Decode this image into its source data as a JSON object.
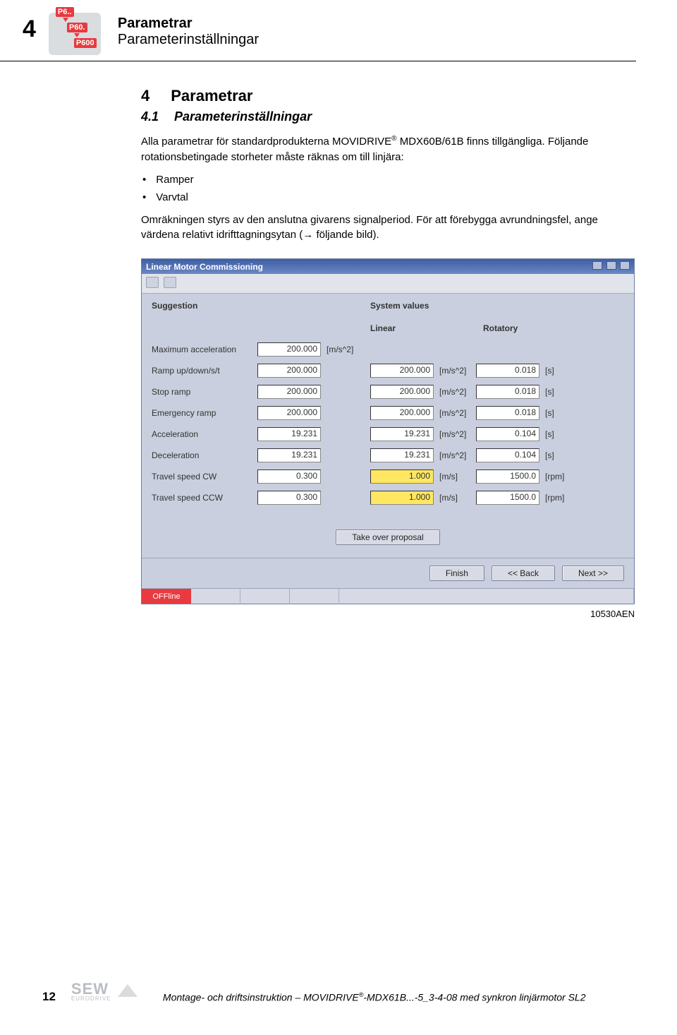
{
  "header": {
    "section_number": "4",
    "icon": {
      "p6": "P6..",
      "p60": "P60.",
      "p600": "P600"
    },
    "title_bold": "Parametrar",
    "title_sub": "Parameterinställningar"
  },
  "content": {
    "h4_num": "4",
    "h4_text": "Parametrar",
    "h41_num": "4.1",
    "h41_text": "Parameterinställningar",
    "para1a": "Alla parametrar för standardprodukterna MOVIDRIVE",
    "para1b": " MDX60B/61B finns tillgängliga. Följande rotationsbetingade storheter måste räknas om till linjära:",
    "bullets": [
      "Ramper",
      "Varvtal"
    ],
    "para2": "Omräkningen styrs av den anslutna givarens signalperiod. För att förebygga avrundningsfel, ange värdena relativt idrifttagningsytan (→ följande bild)."
  },
  "window": {
    "title": "Linear Motor Commissioning",
    "suggestion_label": "Suggestion",
    "system_values_label": "System values",
    "linear_label": "Linear",
    "rotatory_label": "Rotatory",
    "rows": [
      {
        "label": "Maximum acceleration",
        "sugg": "200.000",
        "sugg_unit": "[m/s^2]",
        "lin": "",
        "lin_unit": "",
        "rot": "",
        "rot_unit": ""
      },
      {
        "label": "Ramp up/down/s/t",
        "sugg": "200.000",
        "sugg_unit": "",
        "lin": "200.000",
        "lin_unit": "[m/s^2]",
        "rot": "0.018",
        "rot_unit": "[s]"
      },
      {
        "label": "Stop ramp",
        "sugg": "200.000",
        "sugg_unit": "",
        "lin": "200.000",
        "lin_unit": "[m/s^2]",
        "rot": "0.018",
        "rot_unit": "[s]"
      },
      {
        "label": "Emergency ramp",
        "sugg": "200.000",
        "sugg_unit": "",
        "lin": "200.000",
        "lin_unit": "[m/s^2]",
        "rot": "0.018",
        "rot_unit": "[s]"
      },
      {
        "label": "Acceleration",
        "sugg": "19.231",
        "sugg_unit": "",
        "lin": "19.231",
        "lin_unit": "[m/s^2]",
        "rot": "0.104",
        "rot_unit": "[s]"
      },
      {
        "label": "Deceleration",
        "sugg": "19.231",
        "sugg_unit": "",
        "lin": "19.231",
        "lin_unit": "[m/s^2]",
        "rot": "0.104",
        "rot_unit": "[s]"
      },
      {
        "label": "Travel speed CW",
        "sugg": "0.300",
        "sugg_unit": "",
        "lin": "1.000",
        "lin_unit": "[m/s]",
        "rot": "1500.0",
        "rot_unit": "[rpm]",
        "lin_yellow": true
      },
      {
        "label": "Travel speed CCW",
        "sugg": "0.300",
        "sugg_unit": "",
        "lin": "1.000",
        "lin_unit": "[m/s]",
        "rot": "1500.0",
        "rot_unit": "[rpm]",
        "lin_yellow": true
      }
    ],
    "take_over_btn": "Take over proposal",
    "finish_btn": "Finish",
    "back_btn": "<< Back",
    "next_btn": "Next >>",
    "status": "OFFline"
  },
  "image_id": "10530AEN",
  "footer": {
    "page_num": "12",
    "logo_text": "SEW",
    "logo_sub": "EURODRIVE",
    "text_a": "Montage- och driftsinstruktion – MOVIDRIVE",
    "text_b": "-MDX61B...-5_3-4-08 med synkron linjärmotor SL2"
  }
}
